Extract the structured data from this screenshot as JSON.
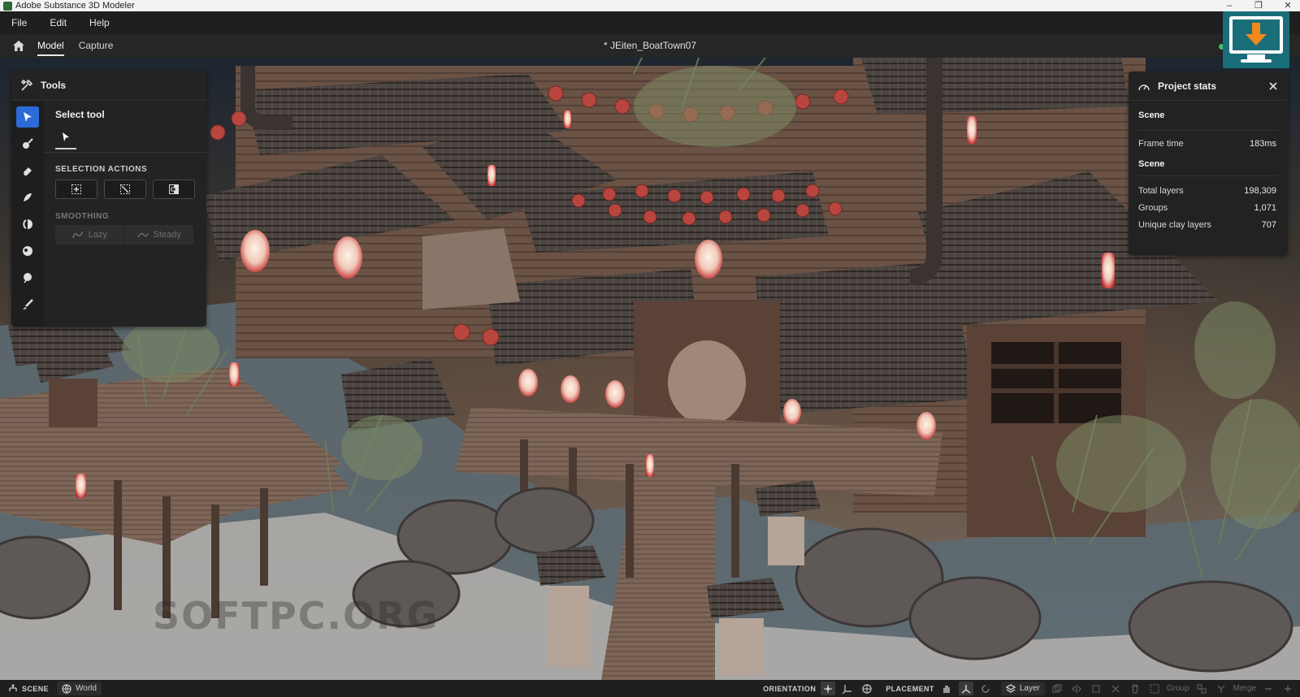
{
  "window": {
    "title": "Adobe Substance 3D Modeler",
    "controls": [
      "–",
      "❐",
      "✕"
    ]
  },
  "menu": [
    "File",
    "Edit",
    "Help"
  ],
  "tabs": [
    {
      "label": "Model",
      "active": true
    },
    {
      "label": "Capture",
      "active": false
    }
  ],
  "document_title": "* JEiten_BoatTown07",
  "tools": {
    "header": "Tools",
    "tool_icons": [
      "select-arrow-icon",
      "brush-icon",
      "eraser-icon",
      "smooth-icon",
      "move-icon",
      "inflate-icon",
      "balloon-icon",
      "paint-icon"
    ],
    "select_title": "Select tool",
    "selection_actions_label": "SELECTION ACTIONS",
    "smoothing_label": "SMOOTHING",
    "smoothing_options": [
      "Lazy",
      "Steady"
    ]
  },
  "stats": {
    "header": "Project stats",
    "section1": "Scene",
    "frame_time_label": "Frame time",
    "frame_time_value": "183ms",
    "section2": "Scene",
    "rows": [
      {
        "label": "Total layers",
        "value": "198,309"
      },
      {
        "label": "Groups",
        "value": "1,071"
      },
      {
        "label": "Unique clay layers",
        "value": "707"
      }
    ]
  },
  "watermark": "SOFTPC.ORG",
  "statusbar": {
    "scene_label": "SCENE",
    "world_label": "World",
    "orientation_label": "ORIENTATION",
    "placement_label": "PLACEMENT",
    "layer_label": "Layer",
    "group_label": "Group",
    "merge_label": "Merge"
  },
  "colors": {
    "accent": "#2b6bd8",
    "status_online": "#3fbf6a",
    "download_badge": "#1a6e7a",
    "download_arrow": "#f08a1c"
  }
}
